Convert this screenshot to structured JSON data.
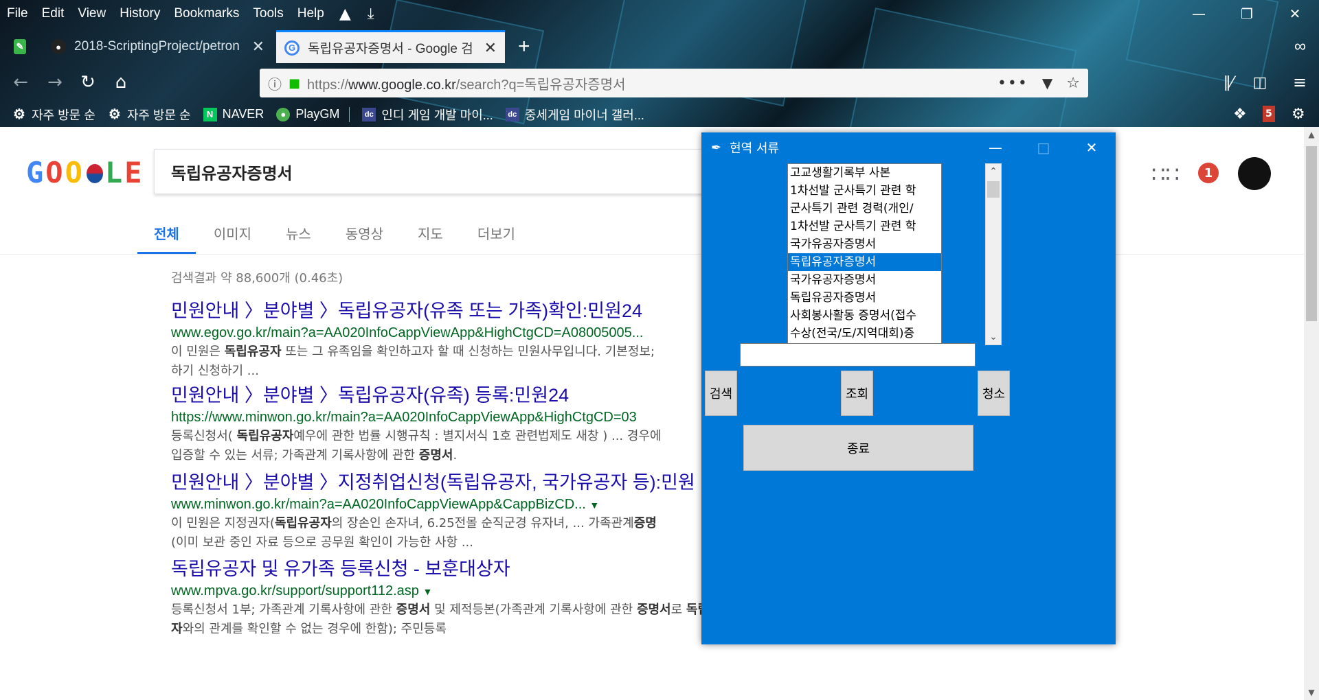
{
  "menubar": {
    "items": [
      "File",
      "Edit",
      "View",
      "History",
      "Bookmarks",
      "Tools",
      "Help"
    ],
    "icons": [
      "library-icon",
      "download-icon"
    ]
  },
  "tabs": [
    {
      "title": "2018-ScriptingProject/petron…",
      "active": false,
      "favicon": "github-icon"
    },
    {
      "title": "독립유공자증명서 - Google 검",
      "active": true,
      "favicon": "google-icon"
    }
  ],
  "navbar": {
    "url_scheme": "https://",
    "url_domain": "www.google.co.kr",
    "url_path": "/search?q=독립유공자증명서"
  },
  "bookmarks": [
    {
      "label": "자주 방문 순",
      "icon": "gear-icon"
    },
    {
      "label": "자주 방문 순",
      "icon": "gear-icon"
    },
    {
      "label": "NAVER",
      "icon": "naver-icon"
    },
    {
      "label": "PlayGM",
      "icon": "playgm-icon"
    },
    {
      "label": "인디 게임 개발 마이...",
      "icon": "dc-icon"
    },
    {
      "label": "중세게임 마이너 갤러...",
      "icon": "dc-icon"
    }
  ],
  "extension_badge": "5",
  "google": {
    "logo_letters": [
      "G",
      "O",
      "O",
      "",
      "L",
      "E"
    ],
    "query": "독립유공자증명서",
    "tabs": [
      "전체",
      "이미지",
      "뉴스",
      "동영상",
      "지도",
      "더보기"
    ],
    "notification_count": "1",
    "stats": "검색결과 약 88,600개 (0.46초)",
    "results": [
      {
        "title": "민원안내 〉분야별 〉독립유공자(유족 또는 가족)확인:민원24",
        "url": "www.egov.go.kr/main?a=AA020InfoCappViewApp&HighCtgCD=A08005005...",
        "snippet_html": "이 민원은 <b>독립유공자</b> 또는 그 유족임을 확인하고자 할 때 신청하는 민원사무입니다. 기본정보;<br>하기 신청하기 ..."
      },
      {
        "title": "민원안내 〉분야별 〉독립유공자(유족) 등록:민원24",
        "url": "https://www.minwon.go.kr/main?a=AA020InfoCappViewApp&HighCtgCD=03",
        "snippet_html": "등록신청서( <b>독립유공자</b>예우에 관한 법률 시행규칙 : 별지서식 1호 관련법제도 새창 ) ... 경우에<br>입증할 수 있는 서류; 가족관계 기록사항에 관한 <b>증명서</b>."
      },
      {
        "title": "민원안내 〉분야별 〉지정취업신청(독립유공자, 국가유공자 등):민원",
        "url": "www.minwon.go.kr/main?a=AA020InfoCappViewApp&CappBizCD...",
        "snippet_html": "이 민원은 지정권자(<b>독립유공자</b>의 장손인 손자녀, 6.25전몰 순직군경 유자녀, ... 가족관계<b>증명</b><br>(이미 보관 중인 자료 등으로 공무원 확인이 가능한 사항 ..."
      },
      {
        "title": "독립유공자 및 유가족 등록신청 - 보훈대상자",
        "url": "www.mpva.go.kr/support/support112.asp",
        "snippet_html": "등록신청서 1부; 가족관계 기록사항에 관한 <b>증명서</b> 및 제적등본(가족관계 기록사항에 관한 <b>증명서</b>로 <b>독립유공</b><br><b>자</b>와의 관계를 확인할 수 없는 경우에 한함); 주민등록"
      }
    ]
  },
  "tkwindow": {
    "title": "현역 서류",
    "list_items": [
      "고교생활기록부 사본",
      "1차선발 군사특기 관련 학",
      "군사특기 관련 경력(개인/",
      "1차선발 군사특기 관련 학",
      "국가유공자증명서",
      "독립유공자증명서",
      "국가유공자증명서",
      "독립유공자증명서",
      "사회봉사활동 증명서(접수",
      "수상(전국/도/지역대회)증"
    ],
    "selected_index": 5,
    "entry_value": "",
    "buttons": {
      "search": "검색",
      "lookup": "조회",
      "clear": "청소",
      "exit": "종료"
    }
  },
  "colors": {
    "tk_background": "#0078d7",
    "link": "#1a0dab",
    "url_green": "#006621",
    "google_blue": "#1a73e8"
  }
}
